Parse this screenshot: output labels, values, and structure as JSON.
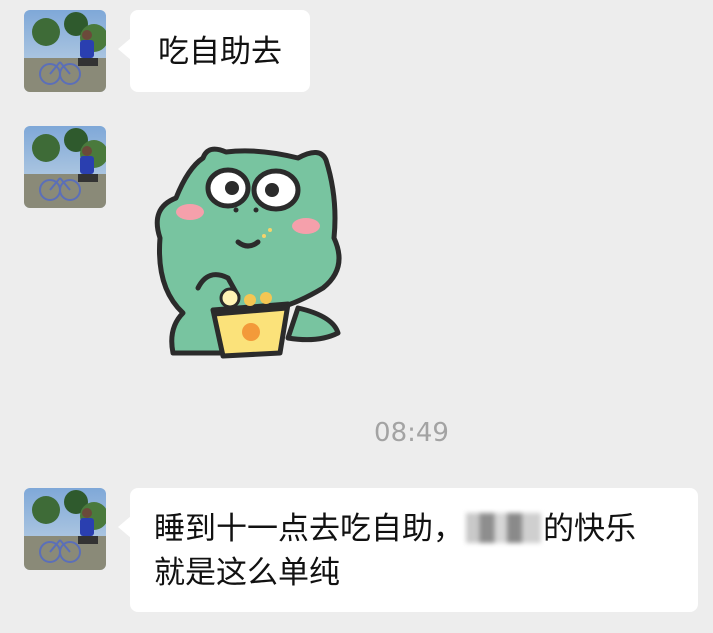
{
  "messages": [
    {
      "type": "text",
      "sender": "contact",
      "text": "吃自助去"
    },
    {
      "type": "sticker",
      "sender": "contact",
      "sticker": "green-dinosaur-eating-popcorn"
    },
    {
      "type": "timestamp",
      "text": "08:49"
    },
    {
      "type": "text",
      "sender": "contact",
      "text_before": "睡到十一点去吃自助，",
      "redacted": true,
      "text_after_line1": "的快乐",
      "text_line2": "就是这么单纯"
    }
  ],
  "colors": {
    "background": "#ededed",
    "bubble": "#ffffff",
    "sticker_green": "#78c4a0",
    "timestamp": "#a3a3a3"
  },
  "icons": {
    "avatar": "avatar-photo-cyclist"
  }
}
